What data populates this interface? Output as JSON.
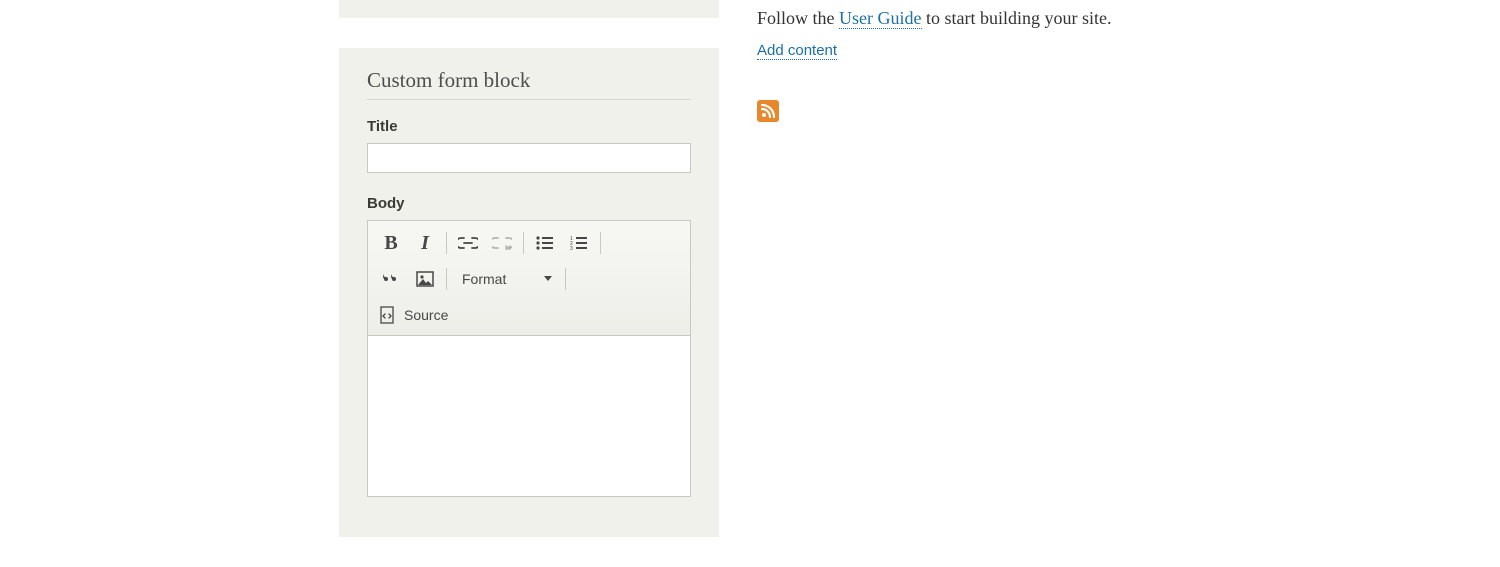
{
  "sidebar": {
    "block_title": "Custom form block",
    "title_field": {
      "label": "Title",
      "value": ""
    },
    "body_field": {
      "label": "Body"
    },
    "toolbar": {
      "bold_glyph": "B",
      "italic_glyph": "I",
      "format_label": "Format",
      "source_label": "Source"
    }
  },
  "main": {
    "intro_prefix": "Follow the ",
    "user_guide_link": "User Guide",
    "intro_suffix": " to start building your site.",
    "add_content_link": "Add content"
  }
}
